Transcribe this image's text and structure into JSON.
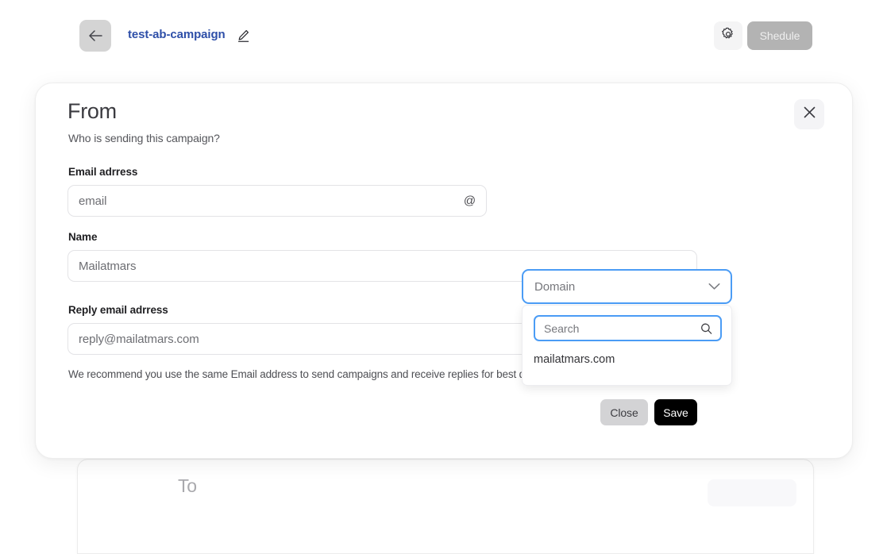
{
  "topbar": {
    "back_icon": "arrow-left-icon",
    "campaign_name": "test-ab-campaign",
    "edit_icon": "pencil-icon",
    "gear_icon": "gear-icon",
    "schedule_label": "Shedule",
    "link_color": "#2e4fa8"
  },
  "background_page": {
    "section_title": "To"
  },
  "modal": {
    "title": "From",
    "subtitle": "Who is sending this campaign?",
    "close_icon": "close-icon",
    "fields": {
      "email": {
        "label": "Email adrress",
        "placeholder": "email",
        "value": "",
        "suffix_symbol": "@"
      },
      "domain": {
        "placeholder": "Domain",
        "value": "",
        "chevron_icon": "chevron-down-icon",
        "focus_color": "#4b9cf5"
      },
      "name": {
        "label": "Name",
        "placeholder": "Mailatmars",
        "value": ""
      },
      "reply": {
        "label": "Reply email adrress",
        "placeholder": "reply@mailatmars.com",
        "value": ""
      }
    },
    "dropdown": {
      "search_placeholder": "Search",
      "search_value": "",
      "search_icon": "search-icon",
      "options": [
        "mailatmars.com"
      ]
    },
    "helper_text": "We recommend you use the same Email address to send campaigns and receive replies for best deliverability.",
    "buttons": {
      "close_label": "Close",
      "save_label": "Save",
      "save_bg": "#000000"
    }
  }
}
